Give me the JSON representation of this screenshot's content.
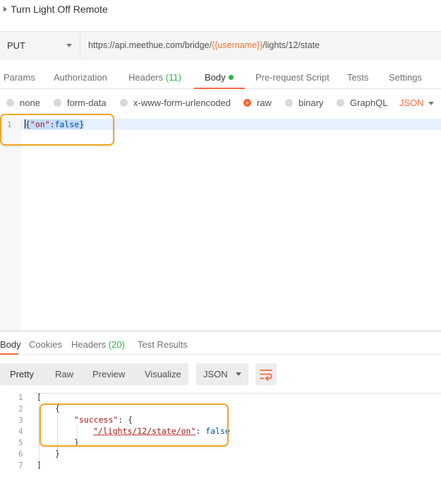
{
  "request": {
    "title": "Turn Light Off Remote",
    "method": "PUT",
    "url_prefix": "https://api.meethue.com/bridge/",
    "url_variable": "{{username}}",
    "url_suffix": "/lights/12/state"
  },
  "request_tabs": {
    "params": "Params",
    "authorization": "Authorization",
    "headers": "Headers",
    "headers_count": "(11)",
    "body": "Body",
    "prerequest": "Pre-request Script",
    "tests": "Tests",
    "settings": "Settings"
  },
  "body_types": {
    "none": "none",
    "form_data": "form-data",
    "urlencoded": "x-www-form-urlencoded",
    "raw": "raw",
    "binary": "binary",
    "graphql": "GraphQL",
    "language": "JSON",
    "selected": "raw"
  },
  "request_body": {
    "line_number": "1",
    "code_open": "{",
    "code_key": "\"on\"",
    "code_sep": ":",
    "code_val": "false",
    "code_close": "}"
  },
  "response_tabs": {
    "body": "Body",
    "cookies": "Cookies",
    "headers": "Headers",
    "headers_count": "(20)",
    "test_results": "Test Results"
  },
  "response_toolbar": {
    "pretty": "Pretty",
    "raw": "Raw",
    "preview": "Preview",
    "visualize": "Visualize",
    "format": "JSON"
  },
  "response_body": {
    "line_numbers": [
      "1",
      "2",
      "3",
      "4",
      "5",
      "6",
      "7"
    ],
    "l1": "[",
    "l2": "{",
    "l3_key": "\"success\"",
    "l3_rest": ": {",
    "l4_key": "\"/lights/12/state/on\"",
    "l4_sep": ": ",
    "l4_val": "false",
    "l5": "}",
    "l6": "}",
    "l7": "]"
  },
  "colors": {
    "accent": "#f26b3a",
    "success": "#2eb34a",
    "highlight_box": "#f5a623"
  }
}
